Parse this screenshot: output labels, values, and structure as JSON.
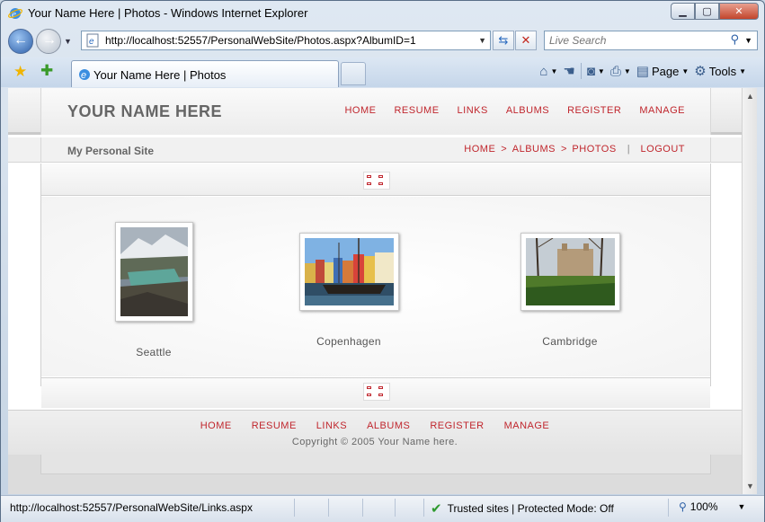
{
  "window": {
    "title": "Your Name Here | Photos - Windows Internet Explorer"
  },
  "address": {
    "url": "http://localhost:52557/PersonalWebSite/Photos.aspx?AlbumID=1"
  },
  "search": {
    "placeholder": "Live Search"
  },
  "tabs": [
    {
      "label": "Your Name Here | Photos"
    }
  ],
  "commandbar": {
    "page_label": "Page",
    "tools_label": "Tools"
  },
  "site": {
    "title": "YOUR NAME HERE",
    "tagline": "My Personal Site",
    "nav": [
      "HOME",
      "RESUME",
      "LINKS",
      "ALBUMS",
      "REGISTER",
      "MANAGE"
    ],
    "breadcrumb": [
      "HOME",
      "ALBUMS",
      "PHOTOS"
    ],
    "breadcrumb_sep": ">",
    "logout": "LOGOUT",
    "pipe": "|"
  },
  "photos": [
    {
      "caption": "Seattle",
      "icon": "mountain-lake-photo"
    },
    {
      "caption": "Copenhagen",
      "icon": "harbor-houses-photo"
    },
    {
      "caption": "Cambridge",
      "icon": "college-lawn-photo"
    }
  ],
  "footer": {
    "nav": [
      "HOME",
      "RESUME",
      "LINKS",
      "ALBUMS",
      "REGISTER",
      "MANAGE"
    ],
    "copyright": "Copyright © 2005 Your Name here."
  },
  "status": {
    "hover_url": "http://localhost:52557/PersonalWebSite/Links.aspx",
    "zone": "Trusted sites | Protected Mode: Off",
    "zoom": "100%"
  },
  "colors": {
    "link_red": "#c0262d",
    "title_gray": "#666666"
  }
}
